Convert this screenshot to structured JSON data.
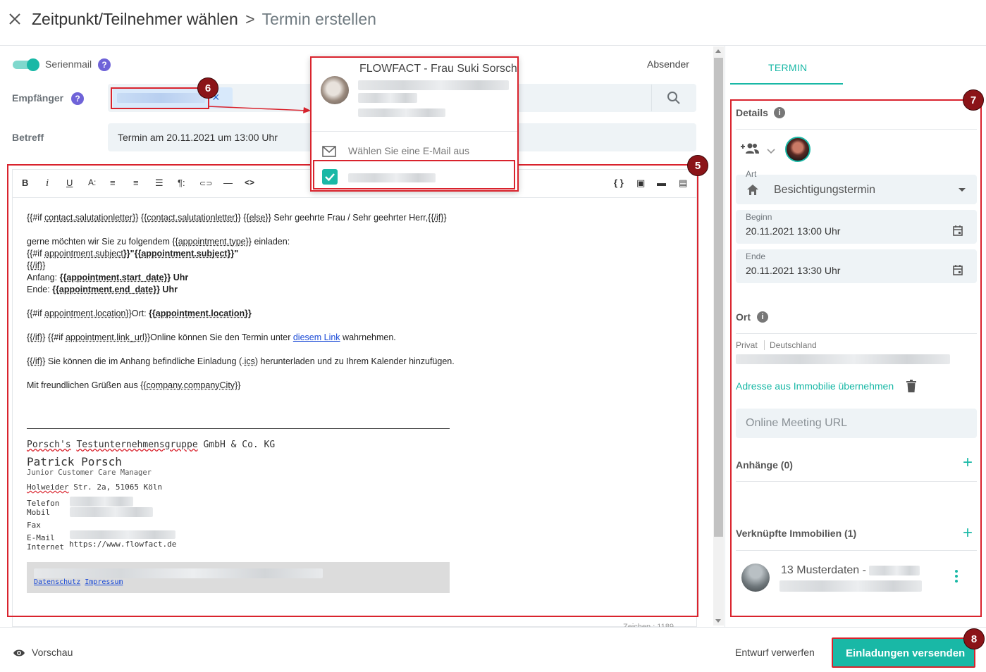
{
  "header": {
    "close_icon": "close-icon",
    "crumb1": "Zeitpunkt/Teilnehmer wählen",
    "sep": ">",
    "crumb2": "Termin erstellen"
  },
  "form": {
    "serienmail_label": "Serienmail",
    "absender_label": "Absender",
    "empfaenger_label": "Empfänger",
    "betreff_label": "Betreff",
    "betreff_value": "Termin am 20.11.2021 um 13:00 Uhr",
    "chip_remove": "×"
  },
  "dropdown": {
    "contact_name": "FLOWFACT - Frau Suki Sorsch",
    "choose_email": "Wählen Sie eine E-Mail aus"
  },
  "toolbar": {
    "bold": "B",
    "italic": "i",
    "underline": "U",
    "fontsize": "A:",
    "align_left": "≡",
    "align_center": "≡",
    "list": "☰",
    "paragraph": "¶:",
    "link": "⊂⊃",
    "hr": "—",
    "code": "<>",
    "vars": "{ }",
    "t1": "▣",
    "t2": "▬",
    "t3": "▤"
  },
  "mail": {
    "l1a": "{{#if ",
    "l1b": "contact.salutationletter",
    "l1c": "}} {{",
    "l1d": "contact.salutationletter",
    "l1e": "}} {{",
    "l1f": "else",
    "l1g": "}} Sehr geehrte Frau / Sehr geehrter Herr,{{",
    "l1h": "/if",
    "l1i": "}}",
    "l2a": "gerne möchten wir Sie zu folgendem {{",
    "l2b": "appointment.type",
    "l2c": "}} einladen:",
    "l3a": "{{#if ",
    "l3b": "appointment.subject",
    "l3c": "}}\"{{",
    "l3d": "appointment.subject",
    "l3e": "}}\"",
    "l4a": "{{",
    "l4b": "/if",
    "l4c": "}}",
    "l5a": "Anfang: ",
    "l5b": "{{",
    "l5c": "appointment.start_date",
    "l5d": "}} Uhr",
    "l6a": "Ende: ",
    "l6b": "{{",
    "l6c": "appointment.end_date",
    "l6d": "}} Uhr",
    "l7a": "{{#if ",
    "l7b": "appointment.location",
    "l7c": "}}Ort: ",
    "l7d": "{{",
    "l7e": "appointment.location",
    "l7f": "}}",
    "l8a": "{{",
    "l8b": "/if",
    "l8c": "}} {{#if ",
    "l8d": "appointment.link_url",
    "l8e": "}}Online können Sie den Termin unter ",
    "l8f": "diesem Link",
    "l8g": " wahrnehmen.",
    "l9a": "{{",
    "l9b": "/if",
    "l9c": "}} Sie können die im Anhang befindliche Einladung (.",
    "l9d": "ics",
    "l9e": ") herunterladen und zu Ihrem Kalender hinzufügen.",
    "l10a": "Mit freundlichen Grüßen aus {{",
    "l10b": "company.companyCity",
    "l10c": "}}"
  },
  "signature": {
    "company_a": "Porsch's",
    "company_b": " ",
    "company_c": "Testunternehmensgruppe",
    "company_d": " GmbH & Co. KG",
    "name": "Patrick Porsch",
    "role": "Junior Customer Care Manager",
    "addr_a": "Holweider",
    "addr_b": " Str. 2a, 51065 Köln",
    "telefon": "Telefon",
    "mobil": "Mobil",
    "fax": "Fax",
    "email": "E-Mail",
    "internet": "Internet",
    "internet_value": "https://www.flowfact.de",
    "datenschutz": "Datenschutz",
    "impressum": "Impressum"
  },
  "char_count": "Zeichen : 1189",
  "sidebar": {
    "tab": "TERMIN",
    "details": "Details",
    "art_label": "Art",
    "art_value": "Besichtigungstermin",
    "beginn_label": "Beginn",
    "beginn_value": "20.11.2021 13:00 Uhr",
    "ende_label": "Ende",
    "ende_value": "20.11.2021 13:30 Uhr",
    "ort": "Ort",
    "privat": "Privat",
    "deutschland": "Deutschland",
    "adresse_link": "Adresse aus Immobilie übernehmen",
    "meeting_placeholder": "Online Meeting URL",
    "anhaenge": "Anhänge (0)",
    "verknuepfte": "Verknüpfte Immobilien (1)",
    "immobilie_title": "13 Musterdaten -",
    "plus": "+"
  },
  "footer": {
    "vorschau": "Vorschau",
    "verwerfen": "Entwurf verwerfen",
    "versenden": "Einladungen versenden"
  },
  "badges": {
    "b5": "5",
    "b6": "6",
    "b7": "7",
    "b8": "8"
  },
  "colors": {
    "accent": "#19b8a6",
    "annotation": "#d9232d",
    "badge": "#8b1418",
    "purple": "#6f63d8"
  }
}
